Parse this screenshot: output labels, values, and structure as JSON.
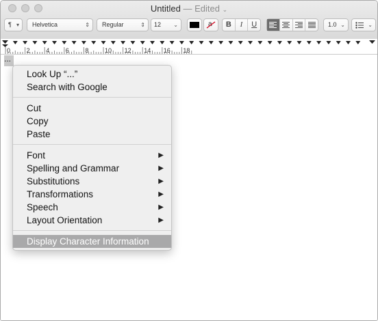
{
  "window": {
    "title": "Untitled",
    "title_status": "— Edited",
    "title_chevron": "⌄"
  },
  "toolbar": {
    "paragraph_style": "¶",
    "font_family": "Helvetica",
    "font_style": "Regular",
    "font_size": "12",
    "bold": "B",
    "italic": "I",
    "underline": "U",
    "line_spacing": "1.0",
    "text_color": "#000000",
    "highlight_glyph": "a",
    "highlight_color": "#ffffff",
    "alignment_selected": "left"
  },
  "ruler": {
    "labels": [
      "0",
      "2",
      "4",
      "6",
      "8",
      "10",
      "12",
      "14",
      "16",
      "18"
    ]
  },
  "document": {
    "selected_text": "..."
  },
  "context_menu": {
    "group1": [
      {
        "label": "Look Up “...”"
      },
      {
        "label": "Search with Google"
      }
    ],
    "group2": [
      {
        "label": "Cut"
      },
      {
        "label": "Copy"
      },
      {
        "label": "Paste"
      }
    ],
    "group3": [
      {
        "label": "Font",
        "submenu": "▶"
      },
      {
        "label": "Spelling and Grammar",
        "submenu": "▶"
      },
      {
        "label": "Substitutions",
        "submenu": "▶"
      },
      {
        "label": "Transformations",
        "submenu": "▶"
      },
      {
        "label": "Speech",
        "submenu": "▶"
      },
      {
        "label": "Layout Orientation",
        "submenu": "▶"
      }
    ],
    "group4": [
      {
        "label": "Display Character Information",
        "highlighted": true
      }
    ]
  }
}
